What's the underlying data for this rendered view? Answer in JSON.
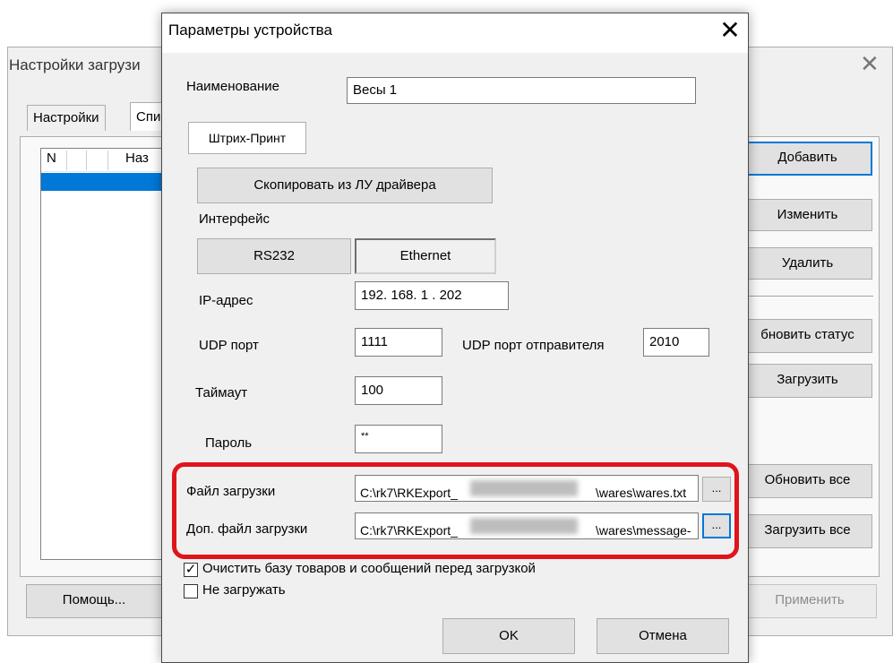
{
  "background_window": {
    "title": "Настройки загрузи",
    "tabs": [
      "Настройки",
      "Спи"
    ],
    "list_headers": [
      "N",
      "",
      "Наз"
    ],
    "buttons": {
      "add": "Добавить",
      "edit": "Изменить",
      "delete": "Удалить",
      "refresh_status": "бновить статус",
      "load": "Загрузить",
      "refresh_all": "Обновить все",
      "load_all": "Загрузить все",
      "help": "Помощь...",
      "apply": "Применить"
    }
  },
  "dialog": {
    "title": "Параметры устройства",
    "name_label": "Наименование",
    "name_value": "Весы 1",
    "driver_tab": "Штрих-Принт",
    "copy_button": "Скопировать из ЛУ драйвера",
    "interface_label": "Интерфейс",
    "interface_options": [
      "RS232",
      "Ethernet"
    ],
    "interface_selected": "Ethernet",
    "ip_label": "IP-адрес",
    "ip_value": "192. 168.   1  . 202",
    "udp_port_label": "UDP порт",
    "udp_port_value": "1111",
    "udp_sender_port_label": "UDP порт отправителя",
    "udp_sender_port_value": "2010",
    "timeout_label": "Таймаут",
    "timeout_value": "100",
    "password_label": "Пароль",
    "password_value": "**",
    "load_file_label": "Файл загрузки",
    "load_file_prefix": "C:\\rk7\\RKExport_",
    "load_file_suffix": "\\wares\\wares.txt",
    "extra_file_label": "Доп. файл загрузки",
    "extra_file_prefix": "C:\\rk7\\RKExport_",
    "extra_file_suffix": "\\wares\\message-",
    "browse_label": "...",
    "clear_db_label": "Очистить базу товаров и сообщений перед загрузкой",
    "clear_db_checked": true,
    "no_load_label": "Не загружать",
    "no_load_checked": false,
    "ok_button": "OK",
    "cancel_button": "Отмена",
    "close_glyph": "✕",
    "check_glyph": "✓"
  },
  "colors": {
    "accent": "#0078d7",
    "highlight": "#e0141b",
    "selection": "#0078d7"
  },
  "icons": {
    "close": "close-icon",
    "checkbox": "checkbox-icon"
  }
}
